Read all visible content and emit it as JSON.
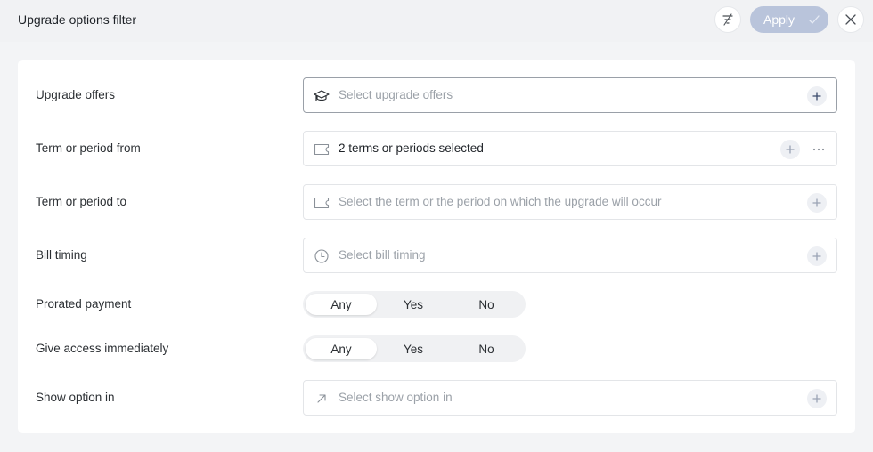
{
  "header": {
    "title": "Upgrade options filter",
    "apply_label": "Apply",
    "filter_icon": "filter-clear-icon",
    "close_icon": "close-icon"
  },
  "colors": {
    "apply_bg": "#b9c4db",
    "page_bg": "#f3f4f6",
    "card_bg": "#ffffff",
    "placeholder": "#9ba1a8"
  },
  "fields": {
    "upgrade_offers": {
      "label": "Upgrade offers",
      "placeholder": "Select upgrade offers",
      "icon": "graduation-cap-icon"
    },
    "term_from": {
      "label": "Term or period from",
      "value": "2 terms or periods selected",
      "icon": "ticket-icon"
    },
    "term_to": {
      "label": "Term or period to",
      "placeholder": "Select the term or the period on which the upgrade will occur",
      "icon": "ticket-icon"
    },
    "bill_timing": {
      "label": "Bill timing",
      "placeholder": "Select bill timing",
      "icon": "clock-icon"
    },
    "show_option_in": {
      "label": "Show option in",
      "placeholder": "Select show option in",
      "icon": "arrow-up-right-icon"
    }
  },
  "toggles": {
    "prorated_payment": {
      "label": "Prorated payment",
      "options": [
        "Any",
        "Yes",
        "No"
      ],
      "selected": "Any"
    },
    "give_access": {
      "label": "Give access immediately",
      "options": [
        "Any",
        "Yes",
        "No"
      ],
      "selected": "Any"
    }
  }
}
